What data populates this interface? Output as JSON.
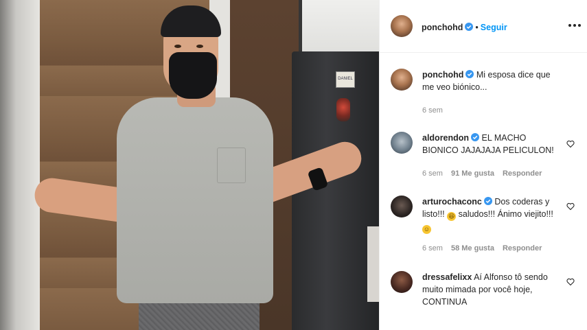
{
  "post": {
    "author": "ponchohd",
    "follow_label": "Seguir",
    "separator": "•",
    "caption": "Mi esposa dice que me veo biónico...",
    "caption_time": "6 sem"
  },
  "photo": {
    "sticker_text": "DANIEL"
  },
  "comments": [
    {
      "username": "aldorendon",
      "text": "EL MACHO BIONICO JAJAJAJA PELICULON!",
      "time": "6 sem",
      "likes": "91 Me gusta",
      "reply_label": "Responder"
    },
    {
      "username": "arturochaconc",
      "text_before": "Dos coderas y listo!!!",
      "emoji1": "laughing-face",
      "text_middle": "saludos!!! Ánimo viejito!!!",
      "emoji2": "smiling-face",
      "time": "6 sem",
      "likes": "58 Me gusta",
      "reply_label": "Responder"
    },
    {
      "username": "dressafelixx",
      "text": "Aí Alfonso tô sendo muito mimada por você hoje, CONTINUA"
    }
  ],
  "icons": {
    "verified": "verified-badge-icon",
    "more": "more-options-icon",
    "like": "heart-icon"
  },
  "colors": {
    "accent": "#0095f6",
    "text": "#262626",
    "secondary": "#8e8e8e",
    "border": "#efefef"
  }
}
